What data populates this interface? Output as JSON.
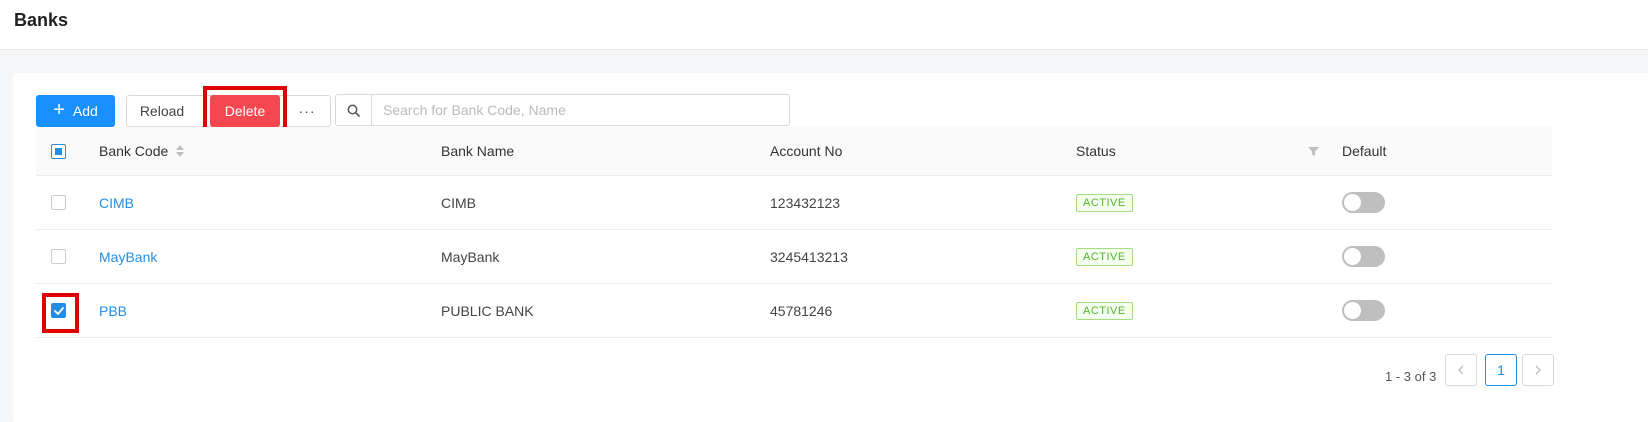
{
  "header": {
    "title": "Banks"
  },
  "toolbar": {
    "add_label": "Add",
    "reload_label": "Reload",
    "delete_label": "Delete",
    "more_label": "···"
  },
  "search": {
    "placeholder": "Search for Bank Code, Name",
    "value": ""
  },
  "table": {
    "columns": {
      "code": "Bank Code",
      "name": "Bank Name",
      "account": "Account No",
      "status": "Status",
      "default": "Default"
    },
    "rows": [
      {
        "code": "CIMB",
        "name": "CIMB",
        "account": "123432123",
        "status": "ACTIVE",
        "selected": false,
        "default": false
      },
      {
        "code": "MayBank",
        "name": "MayBank",
        "account": "3245413213",
        "status": "ACTIVE",
        "selected": false,
        "default": false
      },
      {
        "code": "PBB",
        "name": "PUBLIC BANK",
        "account": "45781246",
        "status": "ACTIVE",
        "selected": true,
        "default": false
      }
    ]
  },
  "pagination": {
    "info": "1 - 3 of 3",
    "current_page": "1"
  },
  "colors": {
    "primary": "#1f8fe8",
    "danger": "#f5474f",
    "highlight": "#e00000",
    "active": "#52b52c"
  }
}
